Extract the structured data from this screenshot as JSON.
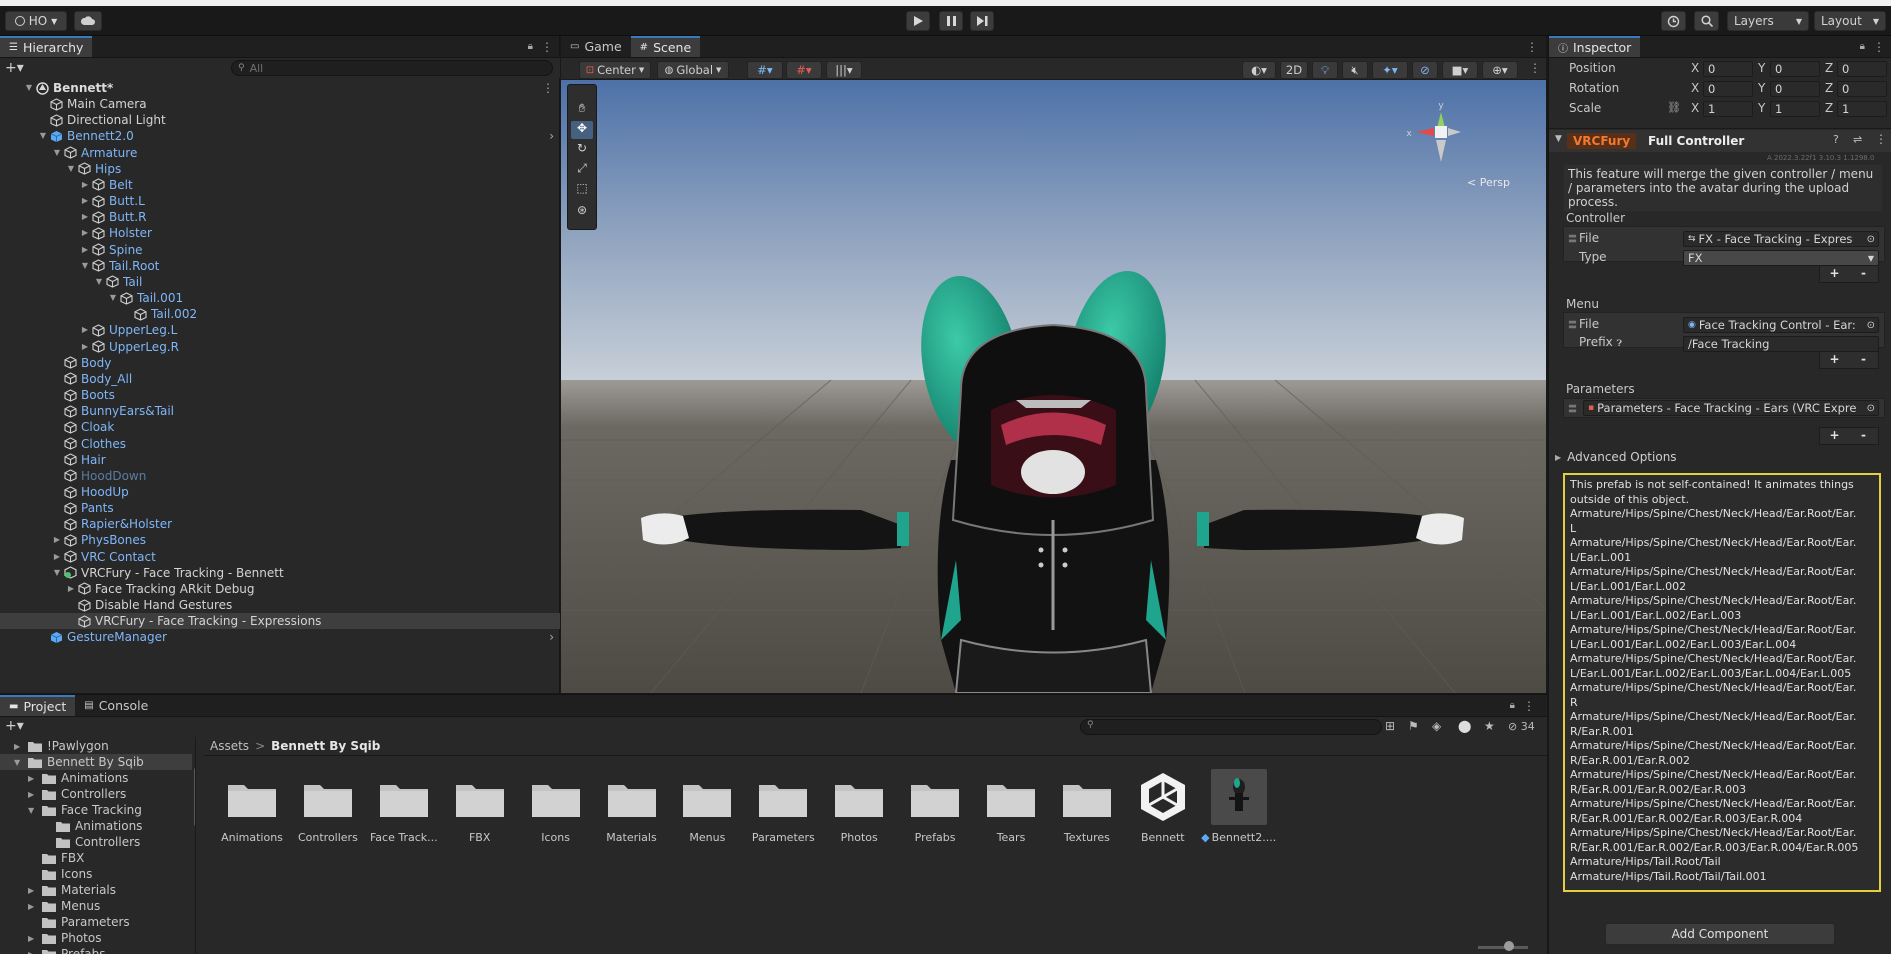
{
  "toolbar": {
    "account_label": "HO",
    "layers_label": "Layers",
    "layout_label": "Layout"
  },
  "hierarchy": {
    "tab_label": "Hierarchy",
    "search_placeholder": "All",
    "items": [
      {
        "label": "Bennett*"
      },
      {
        "label": "Main Camera"
      },
      {
        "label": "Directional Light"
      },
      {
        "label": "Bennett2.0"
      },
      {
        "label": "Armature"
      },
      {
        "label": "Hips"
      },
      {
        "label": "Belt"
      },
      {
        "label": "Butt.L"
      },
      {
        "label": "Butt.R"
      },
      {
        "label": "Holster"
      },
      {
        "label": "Spine"
      },
      {
        "label": "Tail.Root"
      },
      {
        "label": "Tail"
      },
      {
        "label": "Tail.001"
      },
      {
        "label": "Tail.002"
      },
      {
        "label": "UpperLeg.L"
      },
      {
        "label": "UpperLeg.R"
      },
      {
        "label": "Body"
      },
      {
        "label": "Body_All"
      },
      {
        "label": "Boots"
      },
      {
        "label": "BunnyEars&Tail"
      },
      {
        "label": "Cloak"
      },
      {
        "label": "Clothes"
      },
      {
        "label": "Hair"
      },
      {
        "label": "HoodDown"
      },
      {
        "label": "HoodUp"
      },
      {
        "label": "Pants"
      },
      {
        "label": "Rapier&Holster"
      },
      {
        "label": "PhysBones"
      },
      {
        "label": "VRC Contact"
      },
      {
        "label": "VRCFury - Face Tracking - Bennett"
      },
      {
        "label": "Face Tracking ARkit Debug"
      },
      {
        "label": "Disable Hand Gestures"
      },
      {
        "label": "VRCFury - Face Tracking - Expressions"
      },
      {
        "label": "GestureManager"
      }
    ]
  },
  "scene": {
    "tab_game": "Game",
    "tab_scene": "Scene",
    "pivot_label": "Center",
    "space_label": "Global",
    "mode_2d": "2D",
    "persp_label": "< Persp",
    "gizmo_x": "x",
    "gizmo_y": "y"
  },
  "inspector": {
    "tab_label": "Inspector",
    "position_label": "Position",
    "rotation_label": "Rotation",
    "scale_label": "Scale",
    "axis_x": "X",
    "axis_y": "Y",
    "axis_z": "Z",
    "position": [
      "0",
      "0",
      "0"
    ],
    "rotation": [
      "0",
      "0",
      "0"
    ],
    "scale": [
      "1",
      "1",
      "1"
    ],
    "component_brand": "VRCFury",
    "component_name": "Full Controller",
    "version_text": "A 2022.3.22f1 3.10.3 1.1298.0",
    "description": "This feature will merge the given controller / menu / parameters into the avatar during the upload process.",
    "controller_header": "Controller",
    "file_label": "File",
    "controller_file": "FX - Face Tracking - Expres",
    "type_label": "Type",
    "type_value": "FX",
    "menu_header": "Menu",
    "menu_file": "Face Tracking Control - Ear:",
    "prefix_label": "Prefix",
    "prefix_value": "/Face Tracking",
    "parameters_header": "Parameters",
    "parameters_file": "Parameters - Face Tracking - Ears (VRC Expre",
    "plus": "+",
    "minus": "-",
    "advanced_label": "Advanced Options",
    "warning_lines": [
      "This prefab is not self-contained! It animates things",
      "outside of this object.",
      "Armature/Hips/Spine/Chest/Neck/Head/Ear.Root/Ear.",
      "L",
      "Armature/Hips/Spine/Chest/Neck/Head/Ear.Root/Ear.",
      "L/Ear.L.001",
      "Armature/Hips/Spine/Chest/Neck/Head/Ear.Root/Ear.",
      "L/Ear.L.001/Ear.L.002",
      "Armature/Hips/Spine/Chest/Neck/Head/Ear.Root/Ear.",
      "L/Ear.L.001/Ear.L.002/Ear.L.003",
      "Armature/Hips/Spine/Chest/Neck/Head/Ear.Root/Ear.",
      "L/Ear.L.001/Ear.L.002/Ear.L.003/Ear.L.004",
      "Armature/Hips/Spine/Chest/Neck/Head/Ear.Root/Ear.",
      "L/Ear.L.001/Ear.L.002/Ear.L.003/Ear.L.004/Ear.L.005",
      "Armature/Hips/Spine/Chest/Neck/Head/Ear.Root/Ear.",
      "R",
      "Armature/Hips/Spine/Chest/Neck/Head/Ear.Root/Ear.",
      "R/Ear.R.001",
      "Armature/Hips/Spine/Chest/Neck/Head/Ear.Root/Ear.",
      "R/Ear.R.001/Ear.R.002",
      "Armature/Hips/Spine/Chest/Neck/Head/Ear.Root/Ear.",
      "R/Ear.R.001/Ear.R.002/Ear.R.003",
      "Armature/Hips/Spine/Chest/Neck/Head/Ear.Root/Ear.",
      "R/Ear.R.001/Ear.R.002/Ear.R.003/Ear.R.004",
      "Armature/Hips/Spine/Chest/Neck/Head/Ear.Root/Ear.",
      "R/Ear.R.001/Ear.R.002/Ear.R.003/Ear.R.004/Ear.R.005",
      "Armature/Hips/Tail.Root/Tail",
      "Armature/Hips/Tail.Root/Tail/Tail.001"
    ],
    "add_component": "Add Component"
  },
  "project": {
    "tab_project": "Project",
    "tab_console": "Console",
    "hidden_count": "34",
    "tree": [
      {
        "label": "!Pawlygon"
      },
      {
        "label": "Bennett By Sqib"
      },
      {
        "label": "Animations"
      },
      {
        "label": "Controllers"
      },
      {
        "label": "Face Tracking"
      },
      {
        "label": "Animations"
      },
      {
        "label": "Controllers"
      },
      {
        "label": "FBX"
      },
      {
        "label": "Icons"
      },
      {
        "label": "Materials"
      },
      {
        "label": "Menus"
      },
      {
        "label": "Parameters"
      },
      {
        "label": "Photos"
      },
      {
        "label": "Prefabs"
      }
    ],
    "breadcrumb_root": "Assets",
    "breadcrumb_sep": ">",
    "breadcrumb_current": "Bennett By Sqib",
    "assets": [
      {
        "label": "Animations"
      },
      {
        "label": "Controllers"
      },
      {
        "label": "Face Track..."
      },
      {
        "label": "FBX"
      },
      {
        "label": "Icons"
      },
      {
        "label": "Materials"
      },
      {
        "label": "Menus"
      },
      {
        "label": "Parameters"
      },
      {
        "label": "Photos"
      },
      {
        "label": "Prefabs"
      },
      {
        "label": "Tears"
      },
      {
        "label": "Textures"
      },
      {
        "label": "Bennett"
      },
      {
        "label": "Bennett2...."
      }
    ]
  },
  "colors": {
    "accent": "#3a79bb",
    "warning_border": "#e6cf3c",
    "vrcfury_brand": "#f07a30",
    "link_blue": "#7fb6f7",
    "sky_top": "#4e72a8",
    "ground": "#5a5650",
    "ear_teal": "#1fa58d"
  }
}
